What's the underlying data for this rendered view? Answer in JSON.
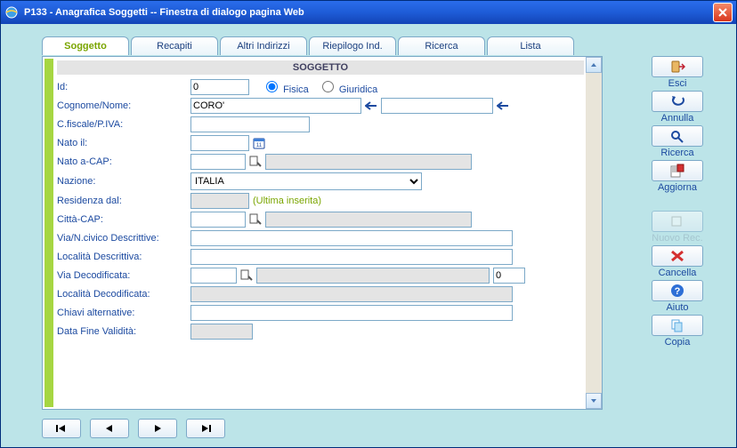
{
  "window": {
    "title": "P133 - Anagrafica Soggetti -- Finestra di dialogo pagina Web"
  },
  "tabs": [
    "Soggetto",
    "Recapiti",
    "Altri Indirizzi",
    "Riepilogo Ind.",
    "Ricerca",
    "Lista"
  ],
  "form": {
    "section_title": "SOGGETTO",
    "labels": {
      "id": "Id:",
      "fisica": "Fisica",
      "giuridica": "Giuridica",
      "cognome_nome": "Cognome/Nome:",
      "cfiscale": "C.fiscale/P.IVA:",
      "nato_il": "Nato il:",
      "nato_a_cap": "Nato a-CAP:",
      "nazione": "Nazione:",
      "residenza_dal": "Residenza dal:",
      "ultima_inserita": "(Ultima inserita)",
      "citta_cap": "Città-CAP:",
      "via_descrittive": "Via/N.civico Descrittive:",
      "localita_descrittiva": "Località Descrittiva:",
      "via_decodificata": "Via Decodificata:",
      "localita_decodificata": "Località Decodificata:",
      "chiavi_alternative": "Chiavi alternative:",
      "data_fine_validita": "Data Fine Validità:"
    },
    "values": {
      "id": "0",
      "cognome": "CORO'",
      "nome": "",
      "nazione": "ITALIA",
      "via_num": "0"
    }
  },
  "actions": {
    "esci": "Esci",
    "annulla": "Annulla",
    "ricerca": "Ricerca",
    "aggiorna": "Aggiorna",
    "nuovo_rec": "Nuovo Rec.",
    "cancella": "Cancella",
    "aiuto": "Aiuto",
    "copia": "Copia"
  }
}
